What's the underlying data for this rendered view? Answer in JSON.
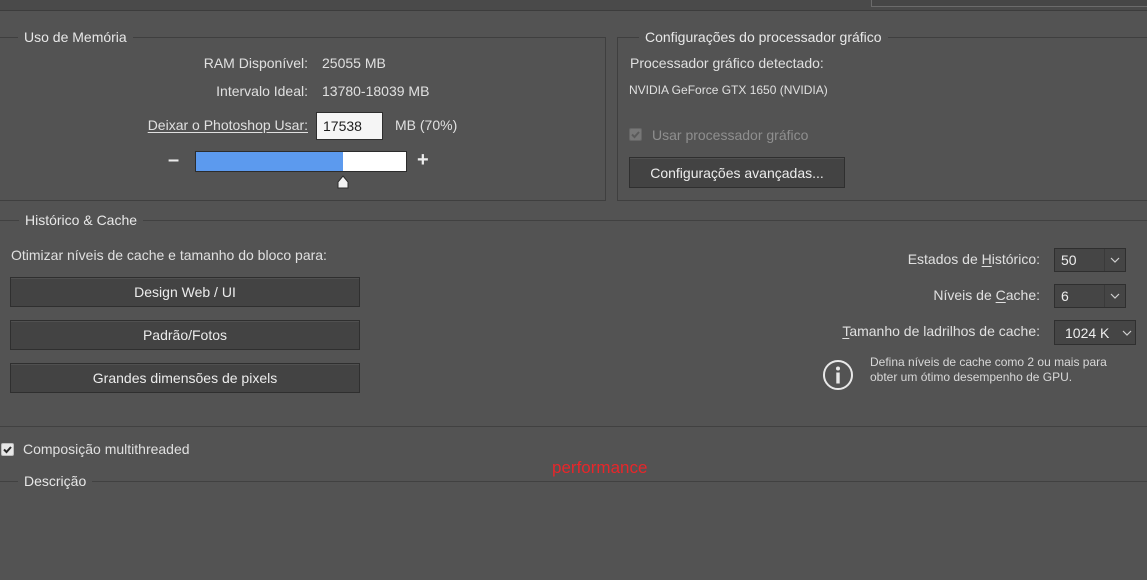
{
  "memory": {
    "legend": "Uso de Memória",
    "ram_label": "RAM Disponível:",
    "ram_value": "25055 MB",
    "ideal_label": "Intervalo Ideal:",
    "ideal_value": "13780-18039 MB",
    "let_label": "Deixar o Photoshop Usar:",
    "let_value": "17538",
    "unit": "MB (70%)",
    "minus": "–",
    "plus": "+",
    "slider_fraction": 0.7
  },
  "gpu": {
    "legend": "Configurações do processador gráfico",
    "detected_label": "Processador gráfico detectado:",
    "detected_value": "NVIDIA GeForce GTX 1650 (NVIDIA)",
    "use_gpu_label": "Usar processador gráfico",
    "use_gpu_checked": true,
    "advanced_button": "Configurações avançadas..."
  },
  "history": {
    "legend": "Histórico & Cache",
    "optimize_label": "Otimizar níveis de cache e tamanho do bloco para:",
    "buttons": [
      "Design Web / UI",
      "Padrão/Fotos",
      "Grandes dimensões de pixels"
    ],
    "states_label": "Estados de Histórico:",
    "states_value": "50",
    "cache_levels_label": "Níveis de Cache:",
    "cache_levels_value": "6",
    "tile_label": "Tamanho de ladrilhos de cache:",
    "tile_value": "1024 K",
    "info_text": "Defina níveis de cache como 2 ou mais para obter um ótimo desempenho de GPU."
  },
  "multithread": {
    "label": "Composição multithreaded",
    "checked": true
  },
  "description": {
    "legend": "Descrição"
  },
  "watermark": "performance",
  "colors": {
    "background": "#535353",
    "slider_fill": "#5c9aee",
    "watermark": "#e8262a"
  }
}
